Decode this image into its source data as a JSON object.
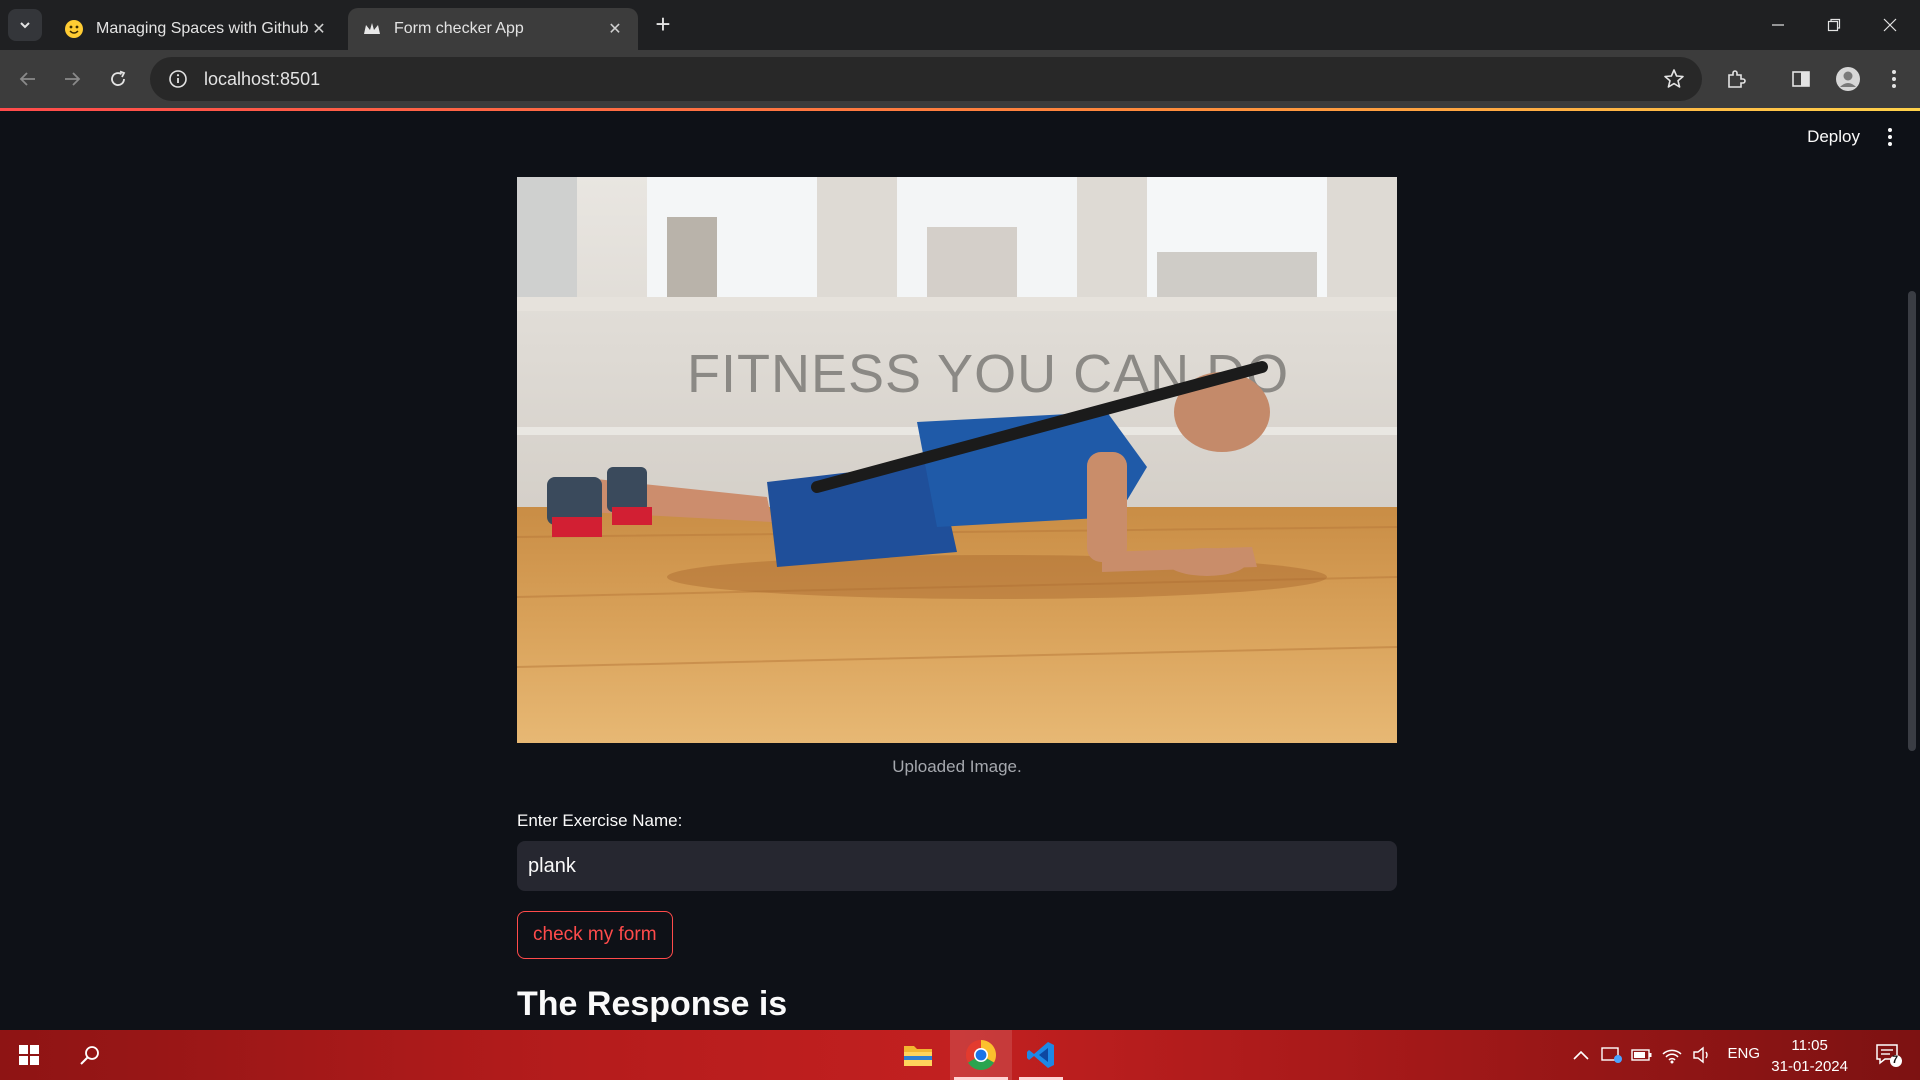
{
  "browser": {
    "tabs": [
      {
        "title": "Managing Spaces with Github A",
        "favicon": "hugging-face-icon",
        "active": false
      },
      {
        "title": "Form checker App",
        "favicon": "streamlit-crown-icon",
        "active": true
      }
    ],
    "url": "localhost:8501"
  },
  "app": {
    "deploy_label": "Deploy",
    "image": {
      "banner_text": "FITNESS YOU CAN DO",
      "caption": "Uploaded Image."
    },
    "exercise_input": {
      "label": "Enter Exercise Name:",
      "value": "plank"
    },
    "submit_button": "check my form",
    "response_heading": "The Response is"
  },
  "taskbar": {
    "apps": [
      "file-explorer-icon",
      "chrome-icon",
      "vscode-icon"
    ],
    "language": "ENG",
    "time": "11:05",
    "date": "31-01-2024",
    "notification_count": "7"
  },
  "colors": {
    "accent": "#ff4b4b",
    "app_background": "#0e1117",
    "input_background": "#262730"
  }
}
